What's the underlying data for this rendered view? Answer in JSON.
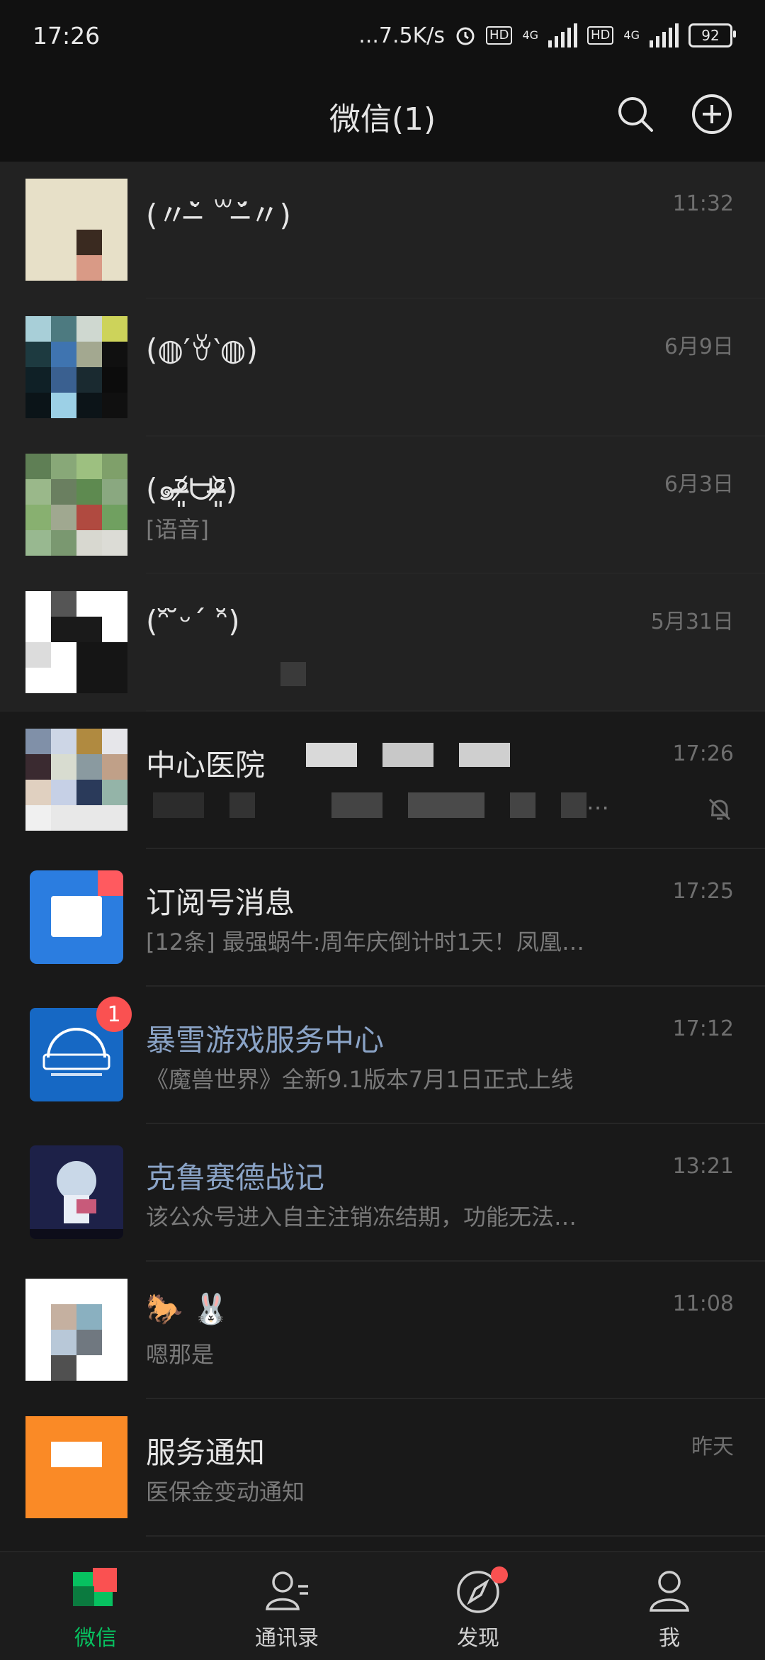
{
  "status": {
    "time": "17:26",
    "net_speed": "...7.5K/s",
    "hd_label": "HD",
    "network_label": "4G",
    "battery": "92"
  },
  "header": {
    "title": "微信(1)"
  },
  "chats": [
    {
      "name": "(〃˘̶̀ ꒳˘̶́〃)",
      "sub": "",
      "time": "11:32"
    },
    {
      "name": "(◍′ꈊ‵◍)",
      "sub": "",
      "time": "6月9日"
    },
    {
      "name": "(๑ᵒ̴̶̷͈᷄ᗨᵒ̴̶̷͈᷅)",
      "sub": "[语音]",
      "time": "6月3日"
    },
    {
      "name": "(ᵔ̆ ̆ᵕ´ ᵔ̆)",
      "sub": "",
      "time": "5月31日"
    },
    {
      "name": "中心医院",
      "sub": "…",
      "time": "17:26"
    },
    {
      "name": "订阅号消息",
      "sub": "[12条] 最强蜗牛:周年庆倒计时1天！凤凰…",
      "time": "17:25"
    },
    {
      "name": "暴雪游戏服务中心",
      "sub": "《魔兽世界》全新9.1版本7月1日正式上线",
      "time": "17:12",
      "badge": "1"
    },
    {
      "name": "克鲁赛德战记",
      "sub": "该公众号进入自主注销冻结期，功能无法…",
      "time": "13:21"
    },
    {
      "name": "🐎 🐰",
      "sub": "嗯那是",
      "time": "11:08"
    },
    {
      "name": "服务通知",
      "sub": "医保金变动通知",
      "time": "昨天"
    }
  ],
  "tabs": [
    {
      "label": "微信"
    },
    {
      "label": "通讯录"
    },
    {
      "label": "发现"
    },
    {
      "label": "我"
    }
  ],
  "colors": {
    "accent": "#07c160",
    "badge": "#fa5151",
    "official": "#8aa3c6"
  }
}
